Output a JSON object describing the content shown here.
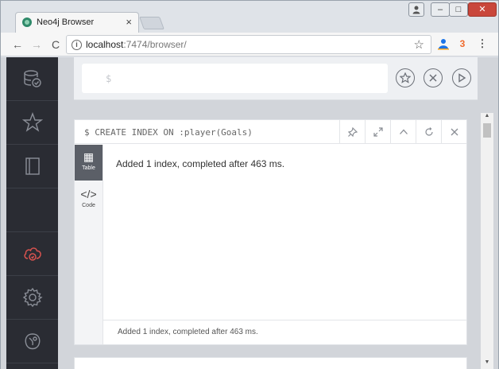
{
  "browser": {
    "tab_title": "Neo4j Browser",
    "tab_close": "×",
    "url_host": "localhost",
    "url_path": ":7474/browser/",
    "controls": {
      "back": "←",
      "forward": "→",
      "reload": "C",
      "minimize": "–",
      "maximize": "□",
      "close": "✕",
      "menu": "⋮"
    },
    "extensions": {
      "d3": "3"
    }
  },
  "sidebar": {
    "items": [
      {
        "name": "database",
        "icon": "database-icon"
      },
      {
        "name": "favorites",
        "icon": "star-icon"
      },
      {
        "name": "documents",
        "icon": "book-icon"
      },
      {
        "name": "sync",
        "icon": "cloud-icon"
      },
      {
        "name": "settings",
        "icon": "gear-icon"
      },
      {
        "name": "about",
        "icon": "neo4j-logo-icon"
      }
    ],
    "active_color": "#d9534f"
  },
  "editor": {
    "prompt": "$"
  },
  "frame": {
    "command": "$ CREATE INDEX ON :player(Goals)",
    "tabs": [
      {
        "label": "Table",
        "icon": "▦"
      },
      {
        "label": "Code",
        "icon": "</>"
      }
    ],
    "message": "Added 1 index, completed after 463 ms.",
    "footer": "Added 1 index, completed after 463 ms."
  }
}
